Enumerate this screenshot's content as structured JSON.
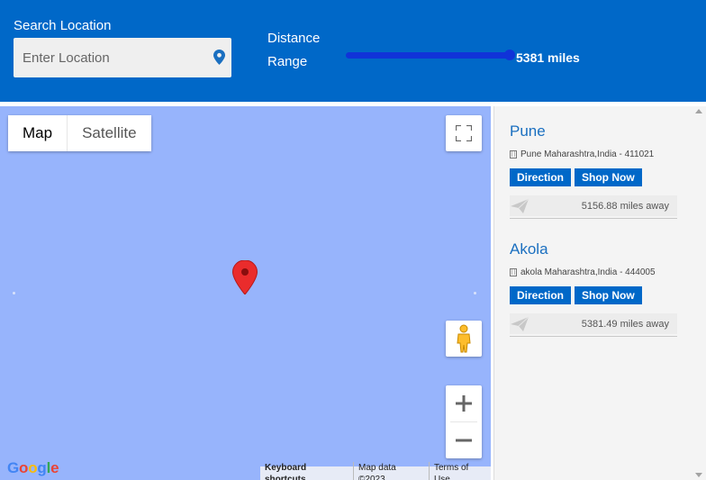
{
  "header": {
    "search_label": "Search Location",
    "search_placeholder": "Enter Location",
    "distance_label": "Distance Range",
    "distance_value": "5381 miles",
    "slider_fraction": 1.0
  },
  "map": {
    "type_tabs": [
      "Map",
      "Satellite"
    ],
    "active_tab": "Map",
    "logo": "Google",
    "attribution": [
      "Keyboard shortcuts",
      "Map data ©2023",
      "Terms of Use"
    ],
    "icons": [
      "location-pin-icon",
      "fullscreen-icon",
      "pegman-icon",
      "zoom-in-icon",
      "zoom-out-icon",
      "map-marker-icon"
    ]
  },
  "stores": [
    {
      "name": "Pune",
      "address": "Pune Maharashtra,India - 411021",
      "direction_label": "Direction",
      "shop_label": "Shop Now",
      "distance": "5156.88 miles away"
    },
    {
      "name": "Akola",
      "address": "akola Maharashtra,India - 444005",
      "direction_label": "Direction",
      "shop_label": "Shop Now",
      "distance": "5381.49 miles away"
    }
  ],
  "colors": {
    "header_bg": "#0068c8",
    "map_water": "#97b4fc",
    "accent": "#1a6fc0",
    "slider": "#1033d8",
    "marker": "#ea2c2c"
  }
}
